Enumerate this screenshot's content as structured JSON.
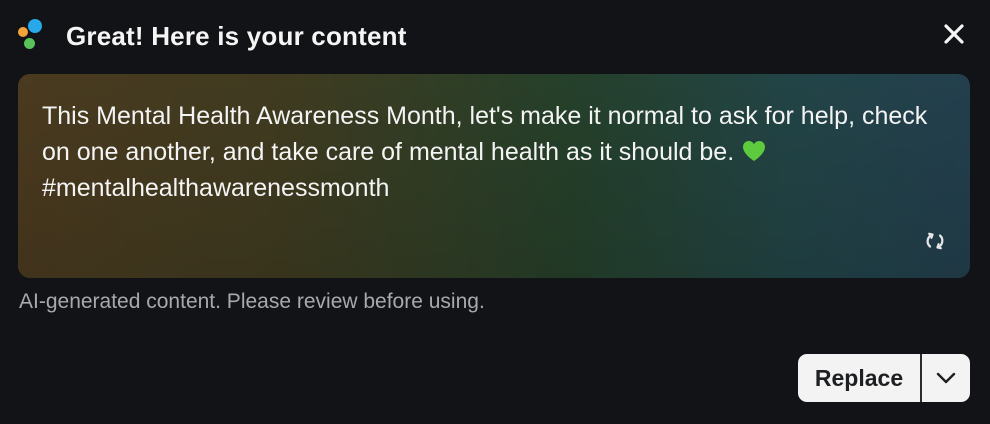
{
  "header": {
    "title": "Great! Here is your content",
    "logo_colors": [
      "#f2a33a",
      "#27a8e8",
      "#58c35a"
    ],
    "close_icon": "close-icon"
  },
  "content": {
    "text_before_emoji": "This Mental Health Awareness Month, let's make it normal to ask for help, check on one another, and take care of mental health as it should be. ",
    "emoji": "green-heart",
    "text_after_emoji": "#mentalhealthawarenessmonth",
    "regenerate_icon": "regenerate-icon"
  },
  "disclaimer": "AI-generated content. Please review before using.",
  "actions": {
    "replace_label": "Replace",
    "dropdown_icon": "chevron-down-icon"
  },
  "colors": {
    "background": "#121316",
    "heart": "#5ecb3f",
    "button_bg": "#f3f3f3"
  }
}
